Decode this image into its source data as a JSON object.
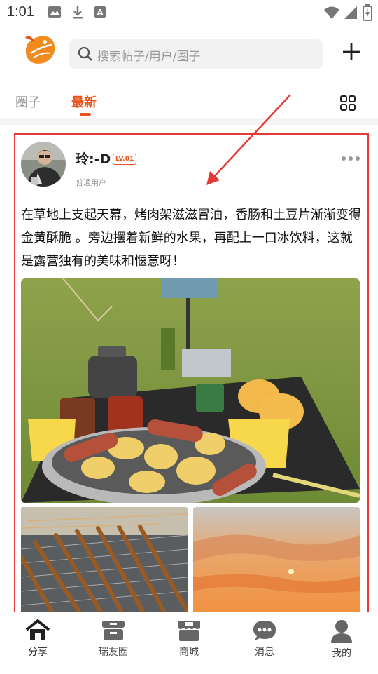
{
  "status_bar": {
    "time": "1:01"
  },
  "search": {
    "placeholder": "搜索帖子/用户/圈子"
  },
  "tabs": [
    {
      "label": "圈子",
      "active": false
    },
    {
      "label": "最新",
      "active": true
    }
  ],
  "post": {
    "username": "玲:-D",
    "level_badge": "LV.01",
    "user_type": "普通用户",
    "text": "在草地上支起天幕，烤肉架滋滋冒油，香肠和土豆片渐渐变得金黄酥脆 。旁边摆着新鲜的水果，再配上一口冰饮料，这就是露营独有的美味和惬意呀！"
  },
  "nav": [
    {
      "label": "分享",
      "icon": "home-icon",
      "active": true
    },
    {
      "label": "瑞友圈",
      "icon": "box-icon",
      "active": false
    },
    {
      "label": "商城",
      "icon": "store-icon",
      "active": false
    },
    {
      "label": "消息",
      "icon": "chat-bubble-icon",
      "active": false
    },
    {
      "label": "我的",
      "icon": "person-icon",
      "active": false
    }
  ],
  "colors": {
    "accent": "#e8541c",
    "annotation": "#e53935"
  }
}
